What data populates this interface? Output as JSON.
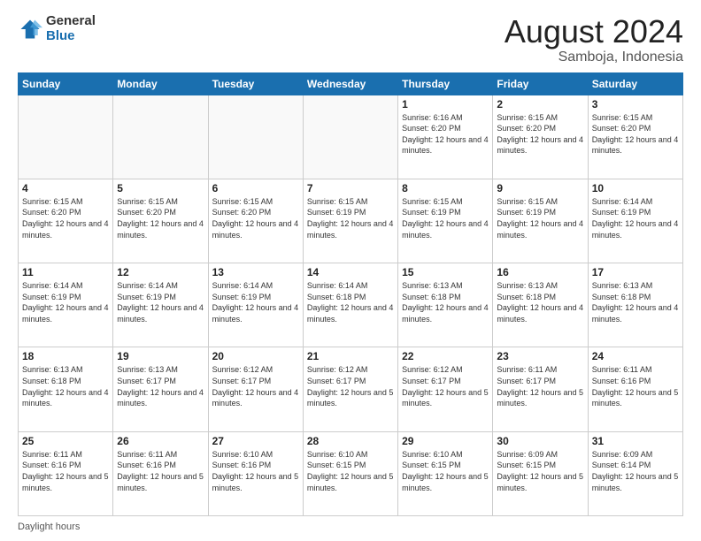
{
  "header": {
    "logo_general": "General",
    "logo_blue": "Blue",
    "month_year": "August 2024",
    "location": "Samboja, Indonesia"
  },
  "footer": {
    "daylight_label": "Daylight hours"
  },
  "days_of_week": [
    "Sunday",
    "Monday",
    "Tuesday",
    "Wednesday",
    "Thursday",
    "Friday",
    "Saturday"
  ],
  "weeks": [
    [
      {
        "day": "",
        "sunrise": "",
        "sunset": "",
        "daylight": "",
        "empty": true
      },
      {
        "day": "",
        "sunrise": "",
        "sunset": "",
        "daylight": "",
        "empty": true
      },
      {
        "day": "",
        "sunrise": "",
        "sunset": "",
        "daylight": "",
        "empty": true
      },
      {
        "day": "",
        "sunrise": "",
        "sunset": "",
        "daylight": "",
        "empty": true
      },
      {
        "day": "1",
        "sunrise": "Sunrise: 6:16 AM",
        "sunset": "Sunset: 6:20 PM",
        "daylight": "Daylight: 12 hours and 4 minutes.",
        "empty": false
      },
      {
        "day": "2",
        "sunrise": "Sunrise: 6:15 AM",
        "sunset": "Sunset: 6:20 PM",
        "daylight": "Daylight: 12 hours and 4 minutes.",
        "empty": false
      },
      {
        "day": "3",
        "sunrise": "Sunrise: 6:15 AM",
        "sunset": "Sunset: 6:20 PM",
        "daylight": "Daylight: 12 hours and 4 minutes.",
        "empty": false
      }
    ],
    [
      {
        "day": "4",
        "sunrise": "Sunrise: 6:15 AM",
        "sunset": "Sunset: 6:20 PM",
        "daylight": "Daylight: 12 hours and 4 minutes.",
        "empty": false
      },
      {
        "day": "5",
        "sunrise": "Sunrise: 6:15 AM",
        "sunset": "Sunset: 6:20 PM",
        "daylight": "Daylight: 12 hours and 4 minutes.",
        "empty": false
      },
      {
        "day": "6",
        "sunrise": "Sunrise: 6:15 AM",
        "sunset": "Sunset: 6:20 PM",
        "daylight": "Daylight: 12 hours and 4 minutes.",
        "empty": false
      },
      {
        "day": "7",
        "sunrise": "Sunrise: 6:15 AM",
        "sunset": "Sunset: 6:19 PM",
        "daylight": "Daylight: 12 hours and 4 minutes.",
        "empty": false
      },
      {
        "day": "8",
        "sunrise": "Sunrise: 6:15 AM",
        "sunset": "Sunset: 6:19 PM",
        "daylight": "Daylight: 12 hours and 4 minutes.",
        "empty": false
      },
      {
        "day": "9",
        "sunrise": "Sunrise: 6:15 AM",
        "sunset": "Sunset: 6:19 PM",
        "daylight": "Daylight: 12 hours and 4 minutes.",
        "empty": false
      },
      {
        "day": "10",
        "sunrise": "Sunrise: 6:14 AM",
        "sunset": "Sunset: 6:19 PM",
        "daylight": "Daylight: 12 hours and 4 minutes.",
        "empty": false
      }
    ],
    [
      {
        "day": "11",
        "sunrise": "Sunrise: 6:14 AM",
        "sunset": "Sunset: 6:19 PM",
        "daylight": "Daylight: 12 hours and 4 minutes.",
        "empty": false
      },
      {
        "day": "12",
        "sunrise": "Sunrise: 6:14 AM",
        "sunset": "Sunset: 6:19 PM",
        "daylight": "Daylight: 12 hours and 4 minutes.",
        "empty": false
      },
      {
        "day": "13",
        "sunrise": "Sunrise: 6:14 AM",
        "sunset": "Sunset: 6:19 PM",
        "daylight": "Daylight: 12 hours and 4 minutes.",
        "empty": false
      },
      {
        "day": "14",
        "sunrise": "Sunrise: 6:14 AM",
        "sunset": "Sunset: 6:18 PM",
        "daylight": "Daylight: 12 hours and 4 minutes.",
        "empty": false
      },
      {
        "day": "15",
        "sunrise": "Sunrise: 6:13 AM",
        "sunset": "Sunset: 6:18 PM",
        "daylight": "Daylight: 12 hours and 4 minutes.",
        "empty": false
      },
      {
        "day": "16",
        "sunrise": "Sunrise: 6:13 AM",
        "sunset": "Sunset: 6:18 PM",
        "daylight": "Daylight: 12 hours and 4 minutes.",
        "empty": false
      },
      {
        "day": "17",
        "sunrise": "Sunrise: 6:13 AM",
        "sunset": "Sunset: 6:18 PM",
        "daylight": "Daylight: 12 hours and 4 minutes.",
        "empty": false
      }
    ],
    [
      {
        "day": "18",
        "sunrise": "Sunrise: 6:13 AM",
        "sunset": "Sunset: 6:18 PM",
        "daylight": "Daylight: 12 hours and 4 minutes.",
        "empty": false
      },
      {
        "day": "19",
        "sunrise": "Sunrise: 6:13 AM",
        "sunset": "Sunset: 6:17 PM",
        "daylight": "Daylight: 12 hours and 4 minutes.",
        "empty": false
      },
      {
        "day": "20",
        "sunrise": "Sunrise: 6:12 AM",
        "sunset": "Sunset: 6:17 PM",
        "daylight": "Daylight: 12 hours and 4 minutes.",
        "empty": false
      },
      {
        "day": "21",
        "sunrise": "Sunrise: 6:12 AM",
        "sunset": "Sunset: 6:17 PM",
        "daylight": "Daylight: 12 hours and 5 minutes.",
        "empty": false
      },
      {
        "day": "22",
        "sunrise": "Sunrise: 6:12 AM",
        "sunset": "Sunset: 6:17 PM",
        "daylight": "Daylight: 12 hours and 5 minutes.",
        "empty": false
      },
      {
        "day": "23",
        "sunrise": "Sunrise: 6:11 AM",
        "sunset": "Sunset: 6:17 PM",
        "daylight": "Daylight: 12 hours and 5 minutes.",
        "empty": false
      },
      {
        "day": "24",
        "sunrise": "Sunrise: 6:11 AM",
        "sunset": "Sunset: 6:16 PM",
        "daylight": "Daylight: 12 hours and 5 minutes.",
        "empty": false
      }
    ],
    [
      {
        "day": "25",
        "sunrise": "Sunrise: 6:11 AM",
        "sunset": "Sunset: 6:16 PM",
        "daylight": "Daylight: 12 hours and 5 minutes.",
        "empty": false
      },
      {
        "day": "26",
        "sunrise": "Sunrise: 6:11 AM",
        "sunset": "Sunset: 6:16 PM",
        "daylight": "Daylight: 12 hours and 5 minutes.",
        "empty": false
      },
      {
        "day": "27",
        "sunrise": "Sunrise: 6:10 AM",
        "sunset": "Sunset: 6:16 PM",
        "daylight": "Daylight: 12 hours and 5 minutes.",
        "empty": false
      },
      {
        "day": "28",
        "sunrise": "Sunrise: 6:10 AM",
        "sunset": "Sunset: 6:15 PM",
        "daylight": "Daylight: 12 hours and 5 minutes.",
        "empty": false
      },
      {
        "day": "29",
        "sunrise": "Sunrise: 6:10 AM",
        "sunset": "Sunset: 6:15 PM",
        "daylight": "Daylight: 12 hours and 5 minutes.",
        "empty": false
      },
      {
        "day": "30",
        "sunrise": "Sunrise: 6:09 AM",
        "sunset": "Sunset: 6:15 PM",
        "daylight": "Daylight: 12 hours and 5 minutes.",
        "empty": false
      },
      {
        "day": "31",
        "sunrise": "Sunrise: 6:09 AM",
        "sunset": "Sunset: 6:14 PM",
        "daylight": "Daylight: 12 hours and 5 minutes.",
        "empty": false
      }
    ]
  ]
}
